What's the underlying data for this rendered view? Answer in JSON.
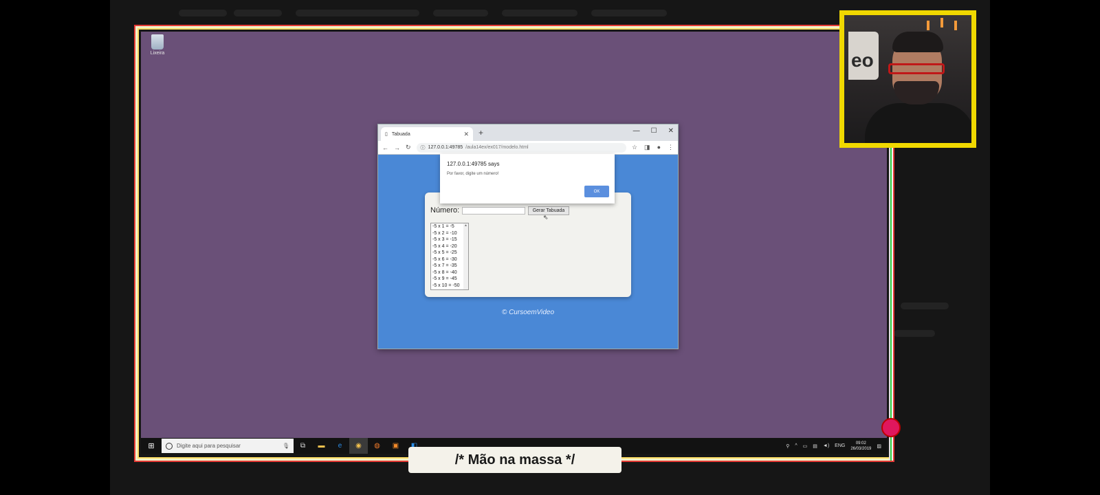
{
  "desktop": {
    "recycle_bin_label": "Lixeira"
  },
  "browser": {
    "tab_title": "Tabuada",
    "tab_close": "✕",
    "new_tab": "+",
    "window_controls": [
      "—",
      "☐",
      "✕"
    ],
    "url_host": "127.0.0.1:49785",
    "url_path": "/aula14ex/ex017/modelo.html"
  },
  "alert": {
    "title": "127.0.0.1:49785 says",
    "message": "Por favor, digite um número!",
    "ok_label": "OK"
  },
  "page": {
    "number_label": "Número:",
    "number_value": "",
    "generate_button": "Gerar Tabuada",
    "table_items": [
      "-5 x 1 = -5",
      "-5 x 2 = -10",
      "-5 x 3 = -15",
      "-5 x 4 = -20",
      "-5 x 5 = -25",
      "-5 x 6 = -30",
      "-5 x 7 = -35",
      "-5 x 8 = -40",
      "-5 x 9 = -45",
      "-5 x 10 = -50"
    ],
    "footer": "© CursoemVideo"
  },
  "taskbar": {
    "search_placeholder": "Digite aqui para pesquisar",
    "language": "ENG",
    "time": "09:02",
    "date": "26/03/2019"
  },
  "overlay": {
    "caption": "/* Mão na massa */",
    "cam_logo_text": "eo"
  },
  "colors": {
    "desktop": "#6a5078",
    "page_bg": "#4a88d6",
    "cam_border": "#f0d800",
    "rec_dot": "#e0175d"
  }
}
